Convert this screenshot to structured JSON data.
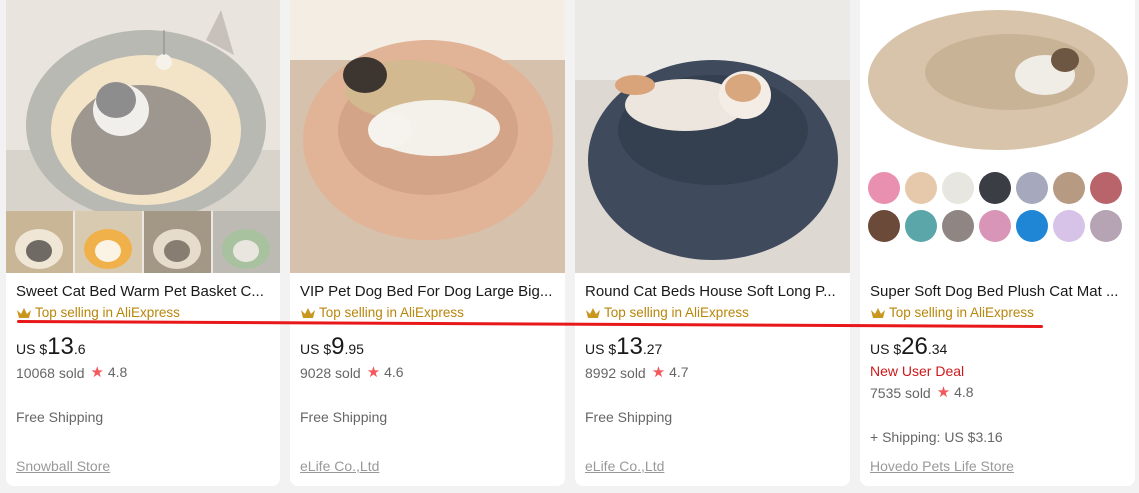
{
  "cards": [
    {
      "title": "Sweet Cat Bed Warm Pet Basket C...",
      "badge": "Top selling in AliExpress",
      "price": {
        "currency": "US $",
        "integer": "13",
        "decimal": ".6"
      },
      "sold": "10068 sold",
      "rating": "4.8",
      "shipping": "Free Shipping",
      "store": "Snowball Store"
    },
    {
      "title": "VIP Pet Dog Bed For Dog Large Big...",
      "badge": "Top selling in AliExpress",
      "price": {
        "currency": "US $",
        "integer": "9",
        "decimal": ".95"
      },
      "sold": "9028 sold",
      "rating": "4.6",
      "shipping": "Free Shipping",
      "store": "eLife Co.,Ltd"
    },
    {
      "title": "Round Cat Beds House Soft Long P...",
      "badge": "Top selling in AliExpress",
      "price": {
        "currency": "US $",
        "integer": "13",
        "decimal": ".27"
      },
      "sold": "8992 sold",
      "rating": "4.7",
      "shipping": "Free Shipping",
      "store": "eLife Co.,Ltd"
    },
    {
      "title": "Super Soft Dog Bed Plush Cat Mat ...",
      "badge": "Top selling in AliExpress",
      "price": {
        "currency": "US $",
        "integer": "26",
        "decimal": ".34"
      },
      "deal": "New User Deal",
      "sold": "7535 sold",
      "rating": "4.8",
      "shipping": "+ Shipping: US $3.16",
      "store": "Hovedo Pets Life Store"
    }
  ],
  "colors": {
    "badge": "#b8860b",
    "deal": "#cc1818",
    "star": "#f4575c",
    "annotation_line": "#e8181a"
  },
  "swatch_colors": [
    "#e98fb0",
    "#e6c9ab",
    "#e8e6e0",
    "#3b3d45",
    "#a6a9bd",
    "#b69a82",
    "#b8646a",
    "#6b4a3a",
    "#5ba6a8",
    "#8f8582",
    "#d995b8",
    "#1f86d6",
    "#d8c3e8",
    "#b6a4b5"
  ]
}
